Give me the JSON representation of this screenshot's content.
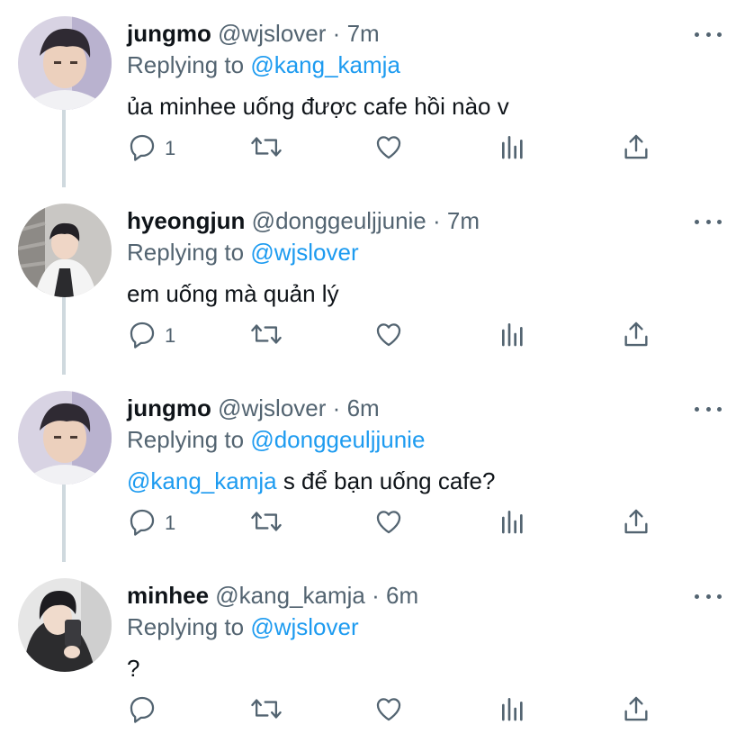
{
  "tweets": [
    {
      "name": "jungmo",
      "handle": "@wjslover",
      "sep": "·",
      "time": "7m",
      "replying_prefix": "Replying to",
      "replying_to": "@kang_kamja",
      "mention": "",
      "text": "ủa minhee uống được cafe hồi nào v",
      "reply_count": "1",
      "avatar": "jungmo-avatar"
    },
    {
      "name": "hyeongjun",
      "handle": "@donggeuljjunie",
      "sep": "·",
      "time": "7m",
      "replying_prefix": "Replying to",
      "replying_to": "@wjslover",
      "mention": "",
      "text": "em uống mà quản lý",
      "reply_count": "1",
      "avatar": "hyeongjun-avatar"
    },
    {
      "name": "jungmo",
      "handle": "@wjslover",
      "sep": "·",
      "time": "6m",
      "replying_prefix": "Replying to",
      "replying_to": "@donggeuljjunie",
      "mention": "@kang_kamja",
      "text": " s để bạn uống cafe?",
      "reply_count": "1",
      "avatar": "jungmo-avatar"
    },
    {
      "name": "minhee",
      "handle": "@kang_kamja",
      "sep": "·",
      "time": "6m",
      "replying_prefix": "Replying to",
      "replying_to": "@wjslover",
      "mention": "",
      "text": "?",
      "reply_count": "",
      "avatar": "minhee-avatar"
    }
  ],
  "colors": {
    "accent": "#1d9bf0",
    "muted": "#536471",
    "text": "#0f1419",
    "thread_line": "#cfd9de"
  },
  "icons": [
    "reply-icon",
    "retweet-icon",
    "like-icon",
    "analytics-icon",
    "share-icon",
    "more-icon"
  ]
}
